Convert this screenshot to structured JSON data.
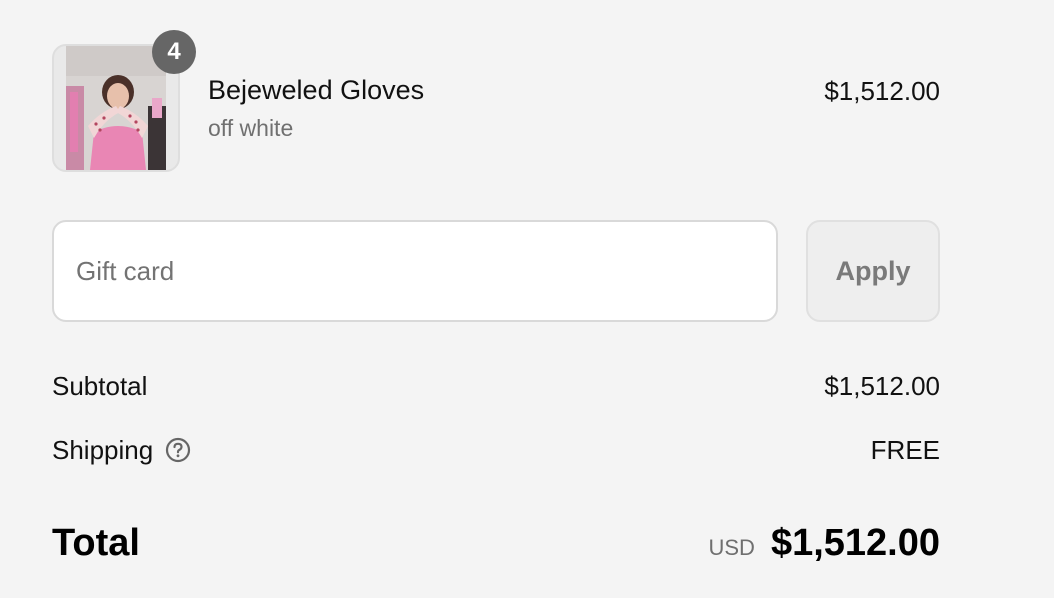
{
  "line_item": {
    "quantity": "4",
    "name": "Bejeweled Gloves",
    "variant": "off white",
    "price": "$1,512.00",
    "image_icon": "product-photo-person-pink-top"
  },
  "gift_card": {
    "placeholder": "Gift card",
    "value": "",
    "apply_label": "Apply"
  },
  "totals": {
    "subtotal_label": "Subtotal",
    "subtotal_value": "$1,512.00",
    "shipping_label": "Shipping",
    "shipping_help_icon": "question-circle-icon",
    "shipping_value": "FREE",
    "total_label": "Total",
    "currency": "USD",
    "total_value": "$1,512.00"
  },
  "colors": {
    "background": "#f4f4f4",
    "badge": "#666666",
    "muted_text": "#707070",
    "input_border": "#d9d9d9"
  }
}
